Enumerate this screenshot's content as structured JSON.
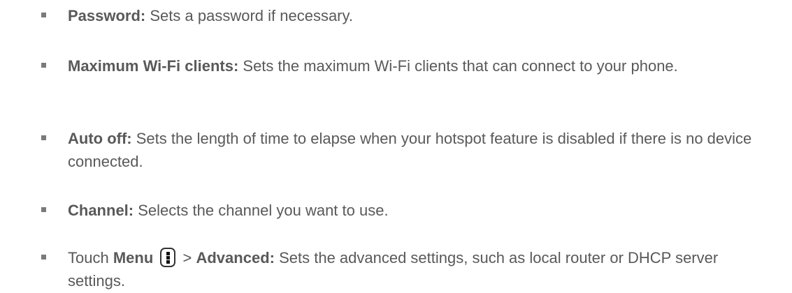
{
  "items": [
    {
      "term": "Password:",
      "text": " Sets a password if necessary."
    },
    {
      "term": "Maximum Wi-Fi clients:",
      "text": " Sets the maximum Wi-Fi clients that can connect to your phone."
    },
    {
      "term": "Auto off:",
      "text": " Sets the length of time to elapse when your hotspot feature is disabled if there is no device connected."
    },
    {
      "term": "Channel:",
      "text": " Selects the channel you want to use."
    }
  ],
  "last_item": {
    "prefix": "Touch ",
    "menu": "Menu",
    "menu_icon": "menu-key-icon",
    "separator": " > ",
    "term": "Advanced:",
    "text": " Sets the advanced settings, such as local router or DHCP server settings."
  }
}
